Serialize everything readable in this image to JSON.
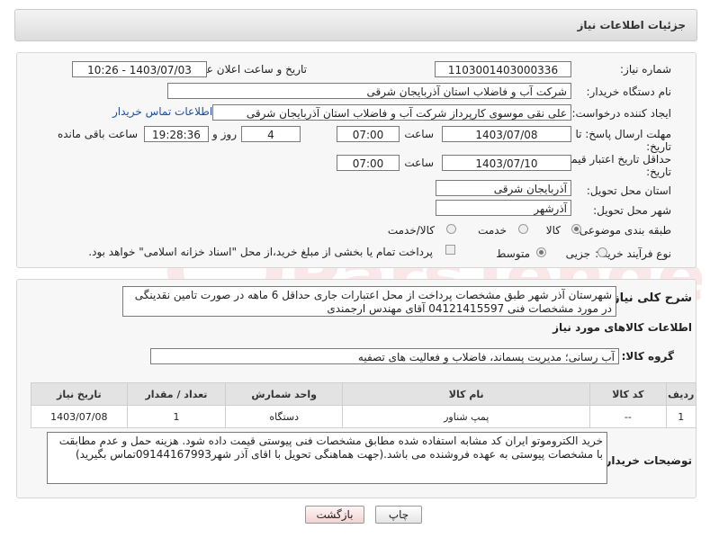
{
  "header": {
    "title": "جزئیات اطلاعات نیاز"
  },
  "form": {
    "need_number_label": "شماره نیاز:",
    "need_number": "1103001403000336",
    "announce_label": "تاریخ و ساعت اعلان عمومی:",
    "announce_value": "1403/07/03 - 10:26",
    "buyer_org_label": "نام دستگاه خریدار:",
    "buyer_org": "شرکت آب و فاضلاب استان آذربایجان شرقی",
    "requester_label": "ایجاد کننده درخواست:",
    "requester": "علی نقی موسوی کارپرداز شرکت آب و فاضلاب استان آذربایجان شرقی",
    "contact_link": "اطلاعات تماس خریدار",
    "deadline_label_1": "مهلت ارسال پاسخ: تا",
    "deadline_label_2": "تاریخ:",
    "deadline_date": "1403/07/08",
    "time_label": "ساعت",
    "deadline_time": "07:00",
    "days_value": "4",
    "days_label": "روز و",
    "remaining_time": "19:28:36",
    "remaining_label": "ساعت باقی مانده",
    "validity_label_1": "حداقل تاریخ اعتبار قیمت: تا",
    "validity_label_2": "تاریخ:",
    "validity_date": "1403/07/10",
    "validity_time": "07:00",
    "province_label": "استان محل تحویل:",
    "province": "آذربایجان شرقی",
    "city_label": "شهر محل تحویل:",
    "city": "آذرشهر",
    "category_label": "طبقه بندی موضوعی:",
    "category_options": [
      "کالا",
      "خدمت",
      "کالا/خدمت"
    ],
    "purchase_type_label": "نوع فرآیند خرید :",
    "purchase_options": [
      "جزیی",
      "متوسط"
    ],
    "payment_note": "پرداخت تمام یا بخشی از مبلغ خرید،از محل \"اسناد خزانه اسلامی\" خواهد بود."
  },
  "details": {
    "description_label": "شرح کلی نیاز:",
    "description": "شهرستان آذر شهر  طبق مشخصات پرداخت از محل اعتبارات جاری حداقل 6 ماهه در صورت تامین نقدینگی در مورد مشخصات فنی 04121415597 آقای مهندس ارجمندی",
    "goods_info_title": "اطلاعات کالاهای مورد نیاز",
    "goods_group_label": "گروه کالا:",
    "goods_group": "آب رسانی؛ مدیریت پسماند، فاضلاب و فعالیت های تصفیه",
    "table": {
      "headers": [
        "ردیف",
        "کد کالا",
        "نام کالا",
        "واحد شمارش",
        "تعداد / مقدار",
        "تاریخ نیاز"
      ],
      "rows": [
        [
          "1",
          "--",
          "پمپ شناور",
          "دستگاه",
          "1",
          "1403/07/08"
        ]
      ]
    },
    "buyer_notes_label": "توضیحات خریدار:",
    "buyer_notes": "خرید   الکتروموتو ایران کد مشابه استفاده شده مطابق مشخصات فنی پیوستی قیمت داده شود. هزینه حمل و عدم مطابقت با مشخصات پیوستی به عهده فروشنده می باشد.(جهت هماهنگی تحویل با اقای آذر شهر09144167993تماس بگیرید)"
  },
  "buttons": {
    "print": "چاپ",
    "back": "بازگشت"
  },
  "watermark": "ParsTender.net"
}
